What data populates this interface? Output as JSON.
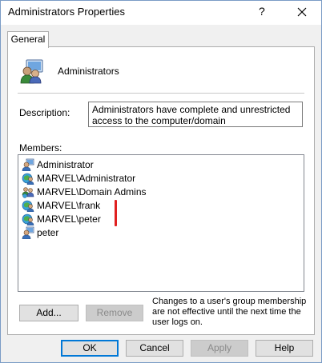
{
  "window": {
    "title": "Administrators Properties",
    "help_glyph": "?",
    "close_icon": "close-icon"
  },
  "tabs": [
    {
      "label": "General",
      "active": true
    }
  ],
  "group": {
    "name": "Administrators",
    "icon": "group-users-icon"
  },
  "description": {
    "label": "Description:",
    "value": "Administrators have complete and unrestricted access to the computer/domain"
  },
  "members": {
    "label": "Members:",
    "items": [
      {
        "name": "Administrator",
        "icon": "local-user-icon"
      },
      {
        "name": "MARVEL\\Administrator",
        "icon": "domain-user-icon"
      },
      {
        "name": "MARVEL\\Domain Admins",
        "icon": "domain-group-icon"
      },
      {
        "name": "MARVEL\\frank",
        "icon": "domain-user-icon"
      },
      {
        "name": "MARVEL\\peter",
        "icon": "domain-user-icon"
      },
      {
        "name": "peter",
        "icon": "local-user-icon"
      }
    ]
  },
  "buttons": {
    "add": "Add...",
    "remove": "Remove",
    "ok": "OK",
    "cancel": "Cancel",
    "apply": "Apply",
    "help": "Help"
  },
  "note": "Changes to a user's group membership are not effective until the next time the user logs on.",
  "colors": {
    "accent": "#0078d7",
    "annotation": "#e02020"
  }
}
